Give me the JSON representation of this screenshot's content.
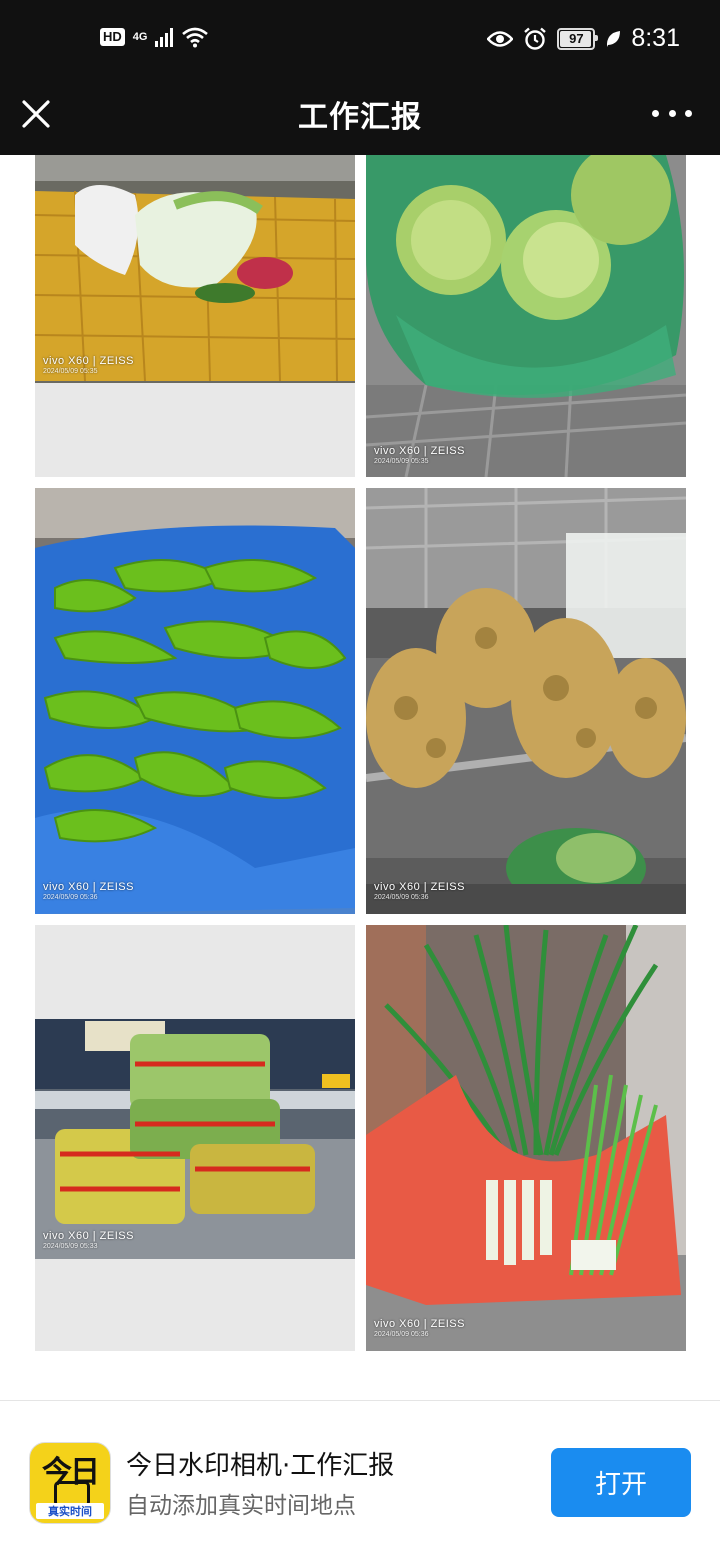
{
  "status_bar": {
    "hd": "HD",
    "network": "4G",
    "battery": "97",
    "battery_level": 0.97,
    "time": "8:31",
    "icons": [
      "signal-icon",
      "wifi-icon",
      "eye-icon",
      "alarm-icon",
      "leaf-icon"
    ]
  },
  "header": {
    "title": "工作汇报",
    "close_icon": "close-icon",
    "more_icon": "more-icon"
  },
  "photos": [
    {
      "subject": "napa cabbage in yellow mesh sack",
      "brand": "vivo X60 | ZEISS",
      "stamp": "2024/05/09 05:35"
    },
    {
      "subject": "cabbage in green plastic bag",
      "brand": "vivo X60 | ZEISS",
      "stamp": "2024/05/09 05:35"
    },
    {
      "subject": "green peppers in blue bag",
      "brand": "vivo X60 | ZEISS",
      "stamp": "2024/05/09 05:36"
    },
    {
      "subject": "ginger in clear bags",
      "brand": "vivo X60 | ZEISS",
      "stamp": "2024/05/09 05:36"
    },
    {
      "subject": "packaged greens on steel table",
      "brand": "vivo X60 | ZEISS",
      "stamp": "2024/05/09 05:33"
    },
    {
      "subject": "scallions and chives in red bag",
      "brand": "vivo X60 | ZEISS",
      "stamp": "2024/05/09 05:36"
    }
  ],
  "banner": {
    "icon_text": "今日",
    "icon_ribbon": "真实时间",
    "app_name": "今日水印相机·工作汇报",
    "description": "自动添加真实时间地点",
    "open_label": "打开"
  },
  "colors": {
    "bar_bg": "#111111",
    "accent": "#1a8cf0"
  }
}
